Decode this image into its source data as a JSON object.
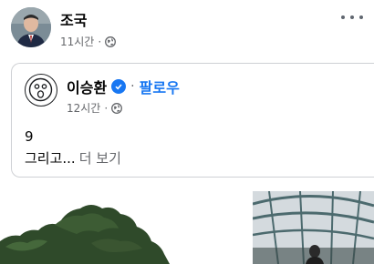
{
  "post": {
    "author": "조국",
    "time": "11시간",
    "audience_icon": "globe-icon",
    "more_icon": "more-horizontal-icon"
  },
  "shared": {
    "author": "이승환",
    "verified_icon": "verified-badge-icon",
    "separator": "·",
    "follow_label": "팔로우",
    "time": "12시간",
    "audience_icon": "globe-icon",
    "text_line1": "9",
    "text_line2": "그리고...",
    "see_more": "더 보기"
  },
  "colors": {
    "accent": "#1877f2",
    "secondary_text": "#65676b",
    "primary_text": "#050505"
  }
}
